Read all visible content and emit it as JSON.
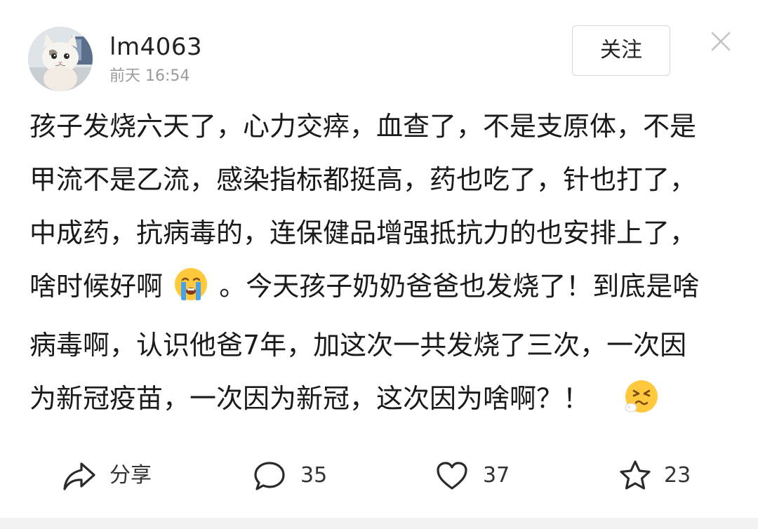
{
  "header": {
    "username": "lm4063",
    "timestamp": "前天  16:54",
    "follow_label": "关注",
    "avatar_icon": "cat-avatar",
    "close_icon": "close-icon"
  },
  "post": {
    "lines": [
      "孩子发烧六天了，心力交瘁，血查了，不是支原体，不是",
      "甲流不是乙流，感染指标都挺高，药也吃了，针也打了，",
      "中成药，抗病毒的，连保健品增强抵抗力的也安排上了，",
      "啥时候好啊",
      "。今天孩子奶奶爸爸也发烧了！到底是啥",
      "病毒啊，认识他爸7年，加这次一共发烧了三次，一次因",
      "为新冠疫苗，一次因为新冠，这次因为啥啊？！"
    ],
    "emojis": [
      "crying-face-emoji",
      "sick-face-emoji"
    ]
  },
  "actions": {
    "share_label": "分享",
    "comment_count": "35",
    "like_count": "37",
    "favorite_count": "23"
  },
  "colors": {
    "text": "#1a1a1a",
    "muted": "#9a9a9a",
    "border": "#d6d6d6",
    "emoji_yellow": "#ffc83d",
    "tear_blue": "#4aa3e8"
  }
}
